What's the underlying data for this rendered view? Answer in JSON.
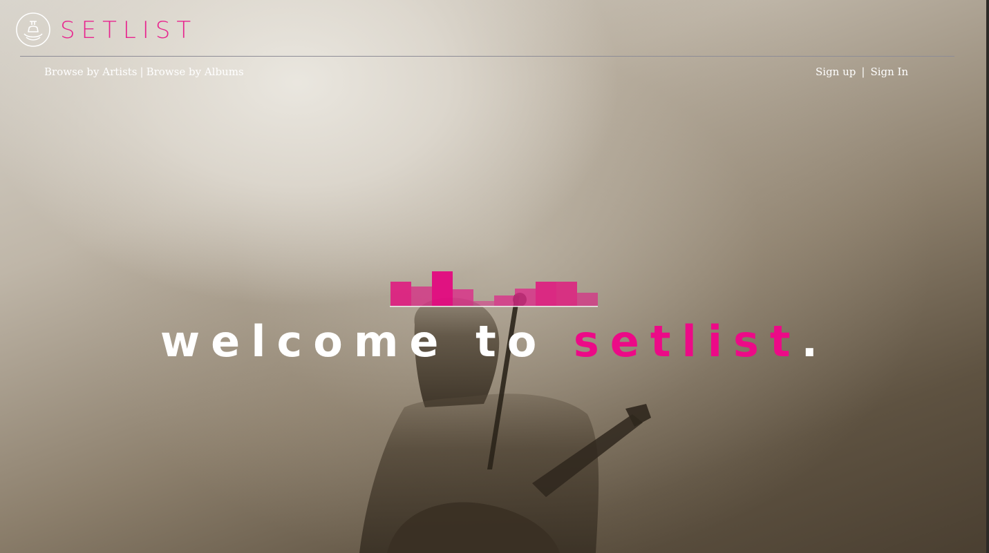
{
  "brand": {
    "name": "SETLIST",
    "logo_icon": "bell-logo-icon",
    "accent_color": "#e8238e"
  },
  "nav": {
    "browse_artists": "Browse by Artists",
    "browse_separator": "|",
    "browse_albums": "Browse by Albums",
    "sign_up": "Sign up",
    "auth_separator": "|",
    "sign_in": "Sign In"
  },
  "hero": {
    "welcome_prefix": "welcome to ",
    "welcome_accent": "setlist",
    "welcome_suffix": ".",
    "equalizer_icon": "equalizer-bars-icon",
    "background": "concert-guitarist-photo"
  }
}
